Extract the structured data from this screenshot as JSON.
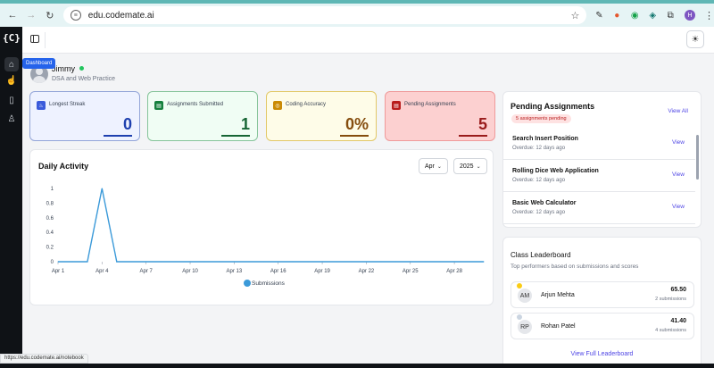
{
  "browser": {
    "url": "edu.codemate.ai",
    "profile_initial": "H",
    "status_url": "https://edu.codemate.ai/notebook"
  },
  "rail": {
    "logo": "{C}",
    "tooltip": "Dashboard",
    "icons": [
      "home-icon",
      "hand-pointer-icon",
      "book-icon",
      "user-icon"
    ]
  },
  "profile": {
    "name": "Jimmy",
    "subtitle": "DSA and Web Practice"
  },
  "stats": [
    {
      "label": "Longest Streak",
      "value": "0",
      "color": "#1e40af",
      "icon": "fire-icon"
    },
    {
      "label": "Assignments Submitted",
      "value": "1",
      "color": "#166534",
      "icon": "document-icon"
    },
    {
      "label": "Coding Accuracy",
      "value": "0%",
      "color": "#854d0e",
      "icon": "target-icon"
    },
    {
      "label": "Pending Assignments",
      "value": "5",
      "color": "#991b1b",
      "icon": "document-icon"
    }
  ],
  "activity": {
    "title": "Daily Activity",
    "month": "Apr",
    "year": "2025"
  },
  "chart_data": {
    "type": "line",
    "x": [
      "Apr 1",
      "Apr 2",
      "Apr 3",
      "Apr 4",
      "Apr 5",
      "Apr 6",
      "Apr 7",
      "Apr 8",
      "Apr 9",
      "Apr 10",
      "Apr 11",
      "Apr 12",
      "Apr 13",
      "Apr 14",
      "Apr 15",
      "Apr 16",
      "Apr 17",
      "Apr 18",
      "Apr 19",
      "Apr 20",
      "Apr 21",
      "Apr 22",
      "Apr 23",
      "Apr 24",
      "Apr 25",
      "Apr 26",
      "Apr 27",
      "Apr 28",
      "Apr 29",
      "Apr 30"
    ],
    "x_ticks": [
      "Apr 1",
      "Apr 4",
      "Apr 7",
      "Apr 10",
      "Apr 13",
      "Apr 16",
      "Apr 19",
      "Apr 22",
      "Apr 25",
      "Apr 28"
    ],
    "series": [
      {
        "name": "Submissions",
        "values": [
          0,
          0,
          0,
          1,
          0,
          0,
          0,
          0,
          0,
          0,
          0,
          0,
          0,
          0,
          0,
          0,
          0,
          0,
          0,
          0,
          0,
          0,
          0,
          0,
          0,
          0,
          0,
          0,
          0,
          0
        ],
        "color": "#3b9ad9"
      }
    ],
    "y_ticks": [
      "0",
      "0.2",
      "0.4",
      "0.6",
      "0.8",
      "1"
    ],
    "ylim": [
      0,
      1
    ],
    "legend": "bottom"
  },
  "pending": {
    "title": "Pending Assignments",
    "view_all": "View All",
    "badge": "5 assignments pending",
    "items": [
      {
        "title": "Search Insert Position",
        "sub": "Overdue: 12 days ago",
        "action": "View"
      },
      {
        "title": "Rolling Dice Web Application",
        "sub": "Overdue: 12 days ago",
        "action": "View"
      },
      {
        "title": "Basic Web Calculator",
        "sub": "Overdue: 12 days ago",
        "action": "View"
      }
    ]
  },
  "leaderboard": {
    "title": "Class Leaderboard",
    "subtitle": "Top performers based on submissions and scores",
    "rows": [
      {
        "initials": "AM",
        "name": "Arjun Mehta",
        "score": "65.50",
        "subs": "2 submissions",
        "medal": "#facc15"
      },
      {
        "initials": "RP",
        "name": "Rohan Patel",
        "score": "41.40",
        "subs": "4 submissions",
        "medal": "#cbd5e1"
      }
    ],
    "view_full": "View Full Leaderboard"
  }
}
